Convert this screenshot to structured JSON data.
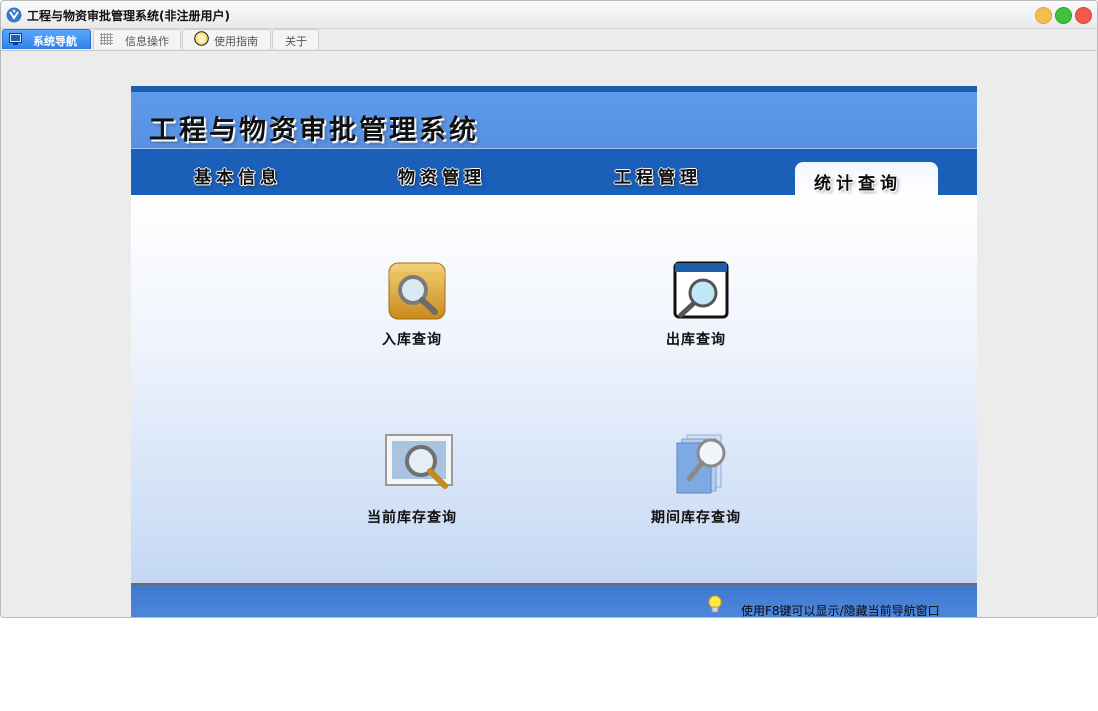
{
  "window": {
    "title": "工程与物资审批管理系统(非注册用户)"
  },
  "tabs": [
    {
      "label": "系统导航",
      "icon": "monitor-icon",
      "active": true
    },
    {
      "label": "信息操作",
      "icon": "grid-icon",
      "active": false
    },
    {
      "label": "使用指南",
      "icon": "compass-icon",
      "active": false
    },
    {
      "label": "关于",
      "icon": "",
      "active": false
    }
  ],
  "panel": {
    "title": "工程与物资审批管理系统",
    "nav": [
      {
        "label": "基本信息",
        "active": false
      },
      {
        "label": "物资管理",
        "active": false
      },
      {
        "label": "工程管理",
        "active": false
      },
      {
        "label": "统计查询",
        "active": true
      }
    ],
    "functions": [
      {
        "label": "入库查询",
        "icon": "folder-search-icon"
      },
      {
        "label": "出库查询",
        "icon": "window-search-icon"
      },
      {
        "label": "当前库存查询",
        "icon": "image-search-icon"
      },
      {
        "label": "期间库存查询",
        "icon": "documents-search-icon"
      }
    ],
    "footer_hint": "使用F8键可以显示/隐藏当前导航窗口"
  },
  "colors": {
    "active_tab": "#2f80ea",
    "header_blue": "#5f9bea",
    "nav_blue": "#1a60b8",
    "close": "#f1584e",
    "minimize": "#f5bd4f",
    "maximize": "#3fc33f"
  }
}
